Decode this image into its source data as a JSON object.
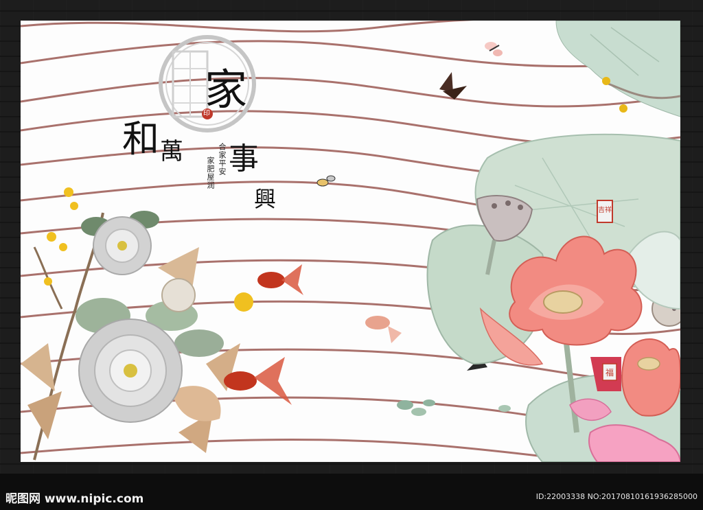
{
  "image": {
    "description_icons": [
      "peony-icon",
      "lotus-icon",
      "goldfish-icon",
      "butterfly-icon",
      "lotus-leaf-icon",
      "window-lattice-icon"
    ],
    "colors": {
      "frame": "#1d1d1d",
      "wall": "#fdfdfd",
      "wave_line": "#a9716c",
      "lotus_pink": "#f07f7a",
      "leaf_green": "#c9dccd",
      "goldfish": "#c2351e",
      "peony_silver": "#d9d9d9"
    }
  },
  "calligraphy": {
    "char_jia": "家",
    "char_he": "和",
    "char_wan": "萬",
    "char_shi": "事",
    "char_xing": "興"
  },
  "poem": {
    "line1": "合家平安",
    "line2": "家肥屋润"
  },
  "seals": {
    "seal_left": "印",
    "seal_right": "吉祥",
    "seal_lotus": "福"
  },
  "watermark": {
    "brand": "昵图网 www.nipic.com",
    "id_text": "ID:22003338 NO:20170810161936285000"
  }
}
